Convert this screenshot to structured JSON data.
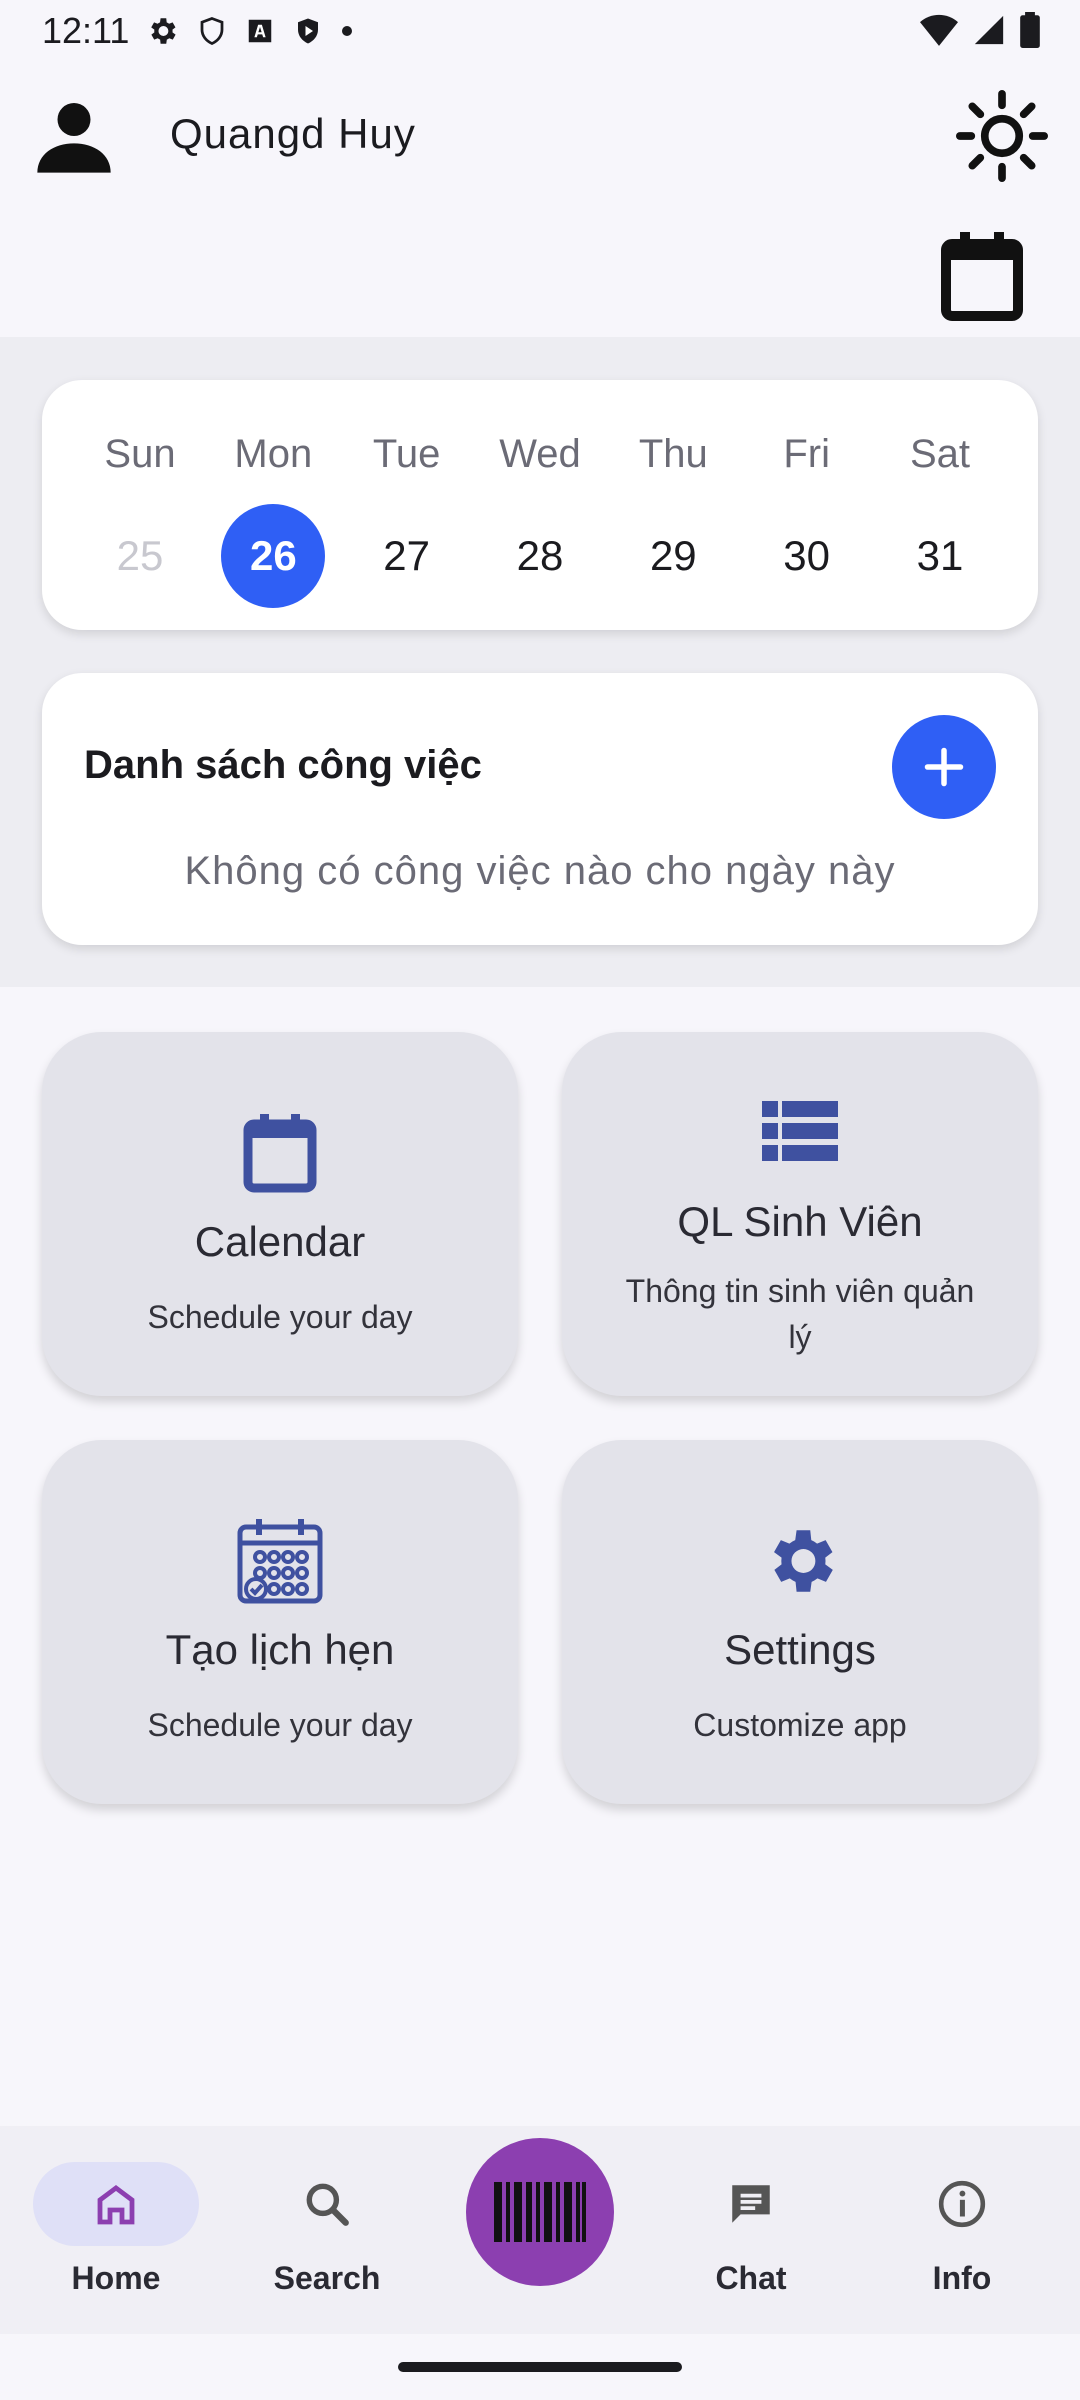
{
  "status_bar": {
    "time": "12:11"
  },
  "header": {
    "username": "Quangd Huy"
  },
  "week": {
    "days": [
      {
        "name": "Sun",
        "num": "25"
      },
      {
        "name": "Mon",
        "num": "26"
      },
      {
        "name": "Tue",
        "num": "27"
      },
      {
        "name": "Wed",
        "num": "28"
      },
      {
        "name": "Thu",
        "num": "29"
      },
      {
        "name": "Fri",
        "num": "30"
      },
      {
        "name": "Sat",
        "num": "31"
      }
    ],
    "selected_day": "26"
  },
  "tasks": {
    "title": "Danh sách công việc",
    "empty_text": "Không có công việc nào cho ngày này"
  },
  "tiles": [
    {
      "title": "Calendar",
      "subtitle": "Schedule your day",
      "icon": "calendar-icon"
    },
    {
      "title": "QL Sinh Viên",
      "subtitle": "Thông tin sinh viên quản lý",
      "icon": "list-icon"
    },
    {
      "title": "Tạo lịch hẹn",
      "subtitle": "Schedule your day",
      "icon": "calendar-schedule-icon"
    },
    {
      "title": "Settings",
      "subtitle": "Customize app",
      "icon": "gear-icon"
    }
  ],
  "bottom_nav": {
    "items": [
      {
        "label": "Home",
        "icon": "home-icon",
        "active": true
      },
      {
        "label": "Search",
        "icon": "search-icon"
      },
      {
        "label": "Chat",
        "icon": "chat-icon"
      },
      {
        "label": "Info",
        "icon": "info-icon"
      }
    ],
    "center_icon": "barcode-icon"
  },
  "colors": {
    "accent": "#2f5ff5",
    "scan_button": "#8c3fb0",
    "tile_bg": "#e3e3ea",
    "tile_icon": "#3f51a0",
    "nav_active": "#dfe0f7"
  }
}
